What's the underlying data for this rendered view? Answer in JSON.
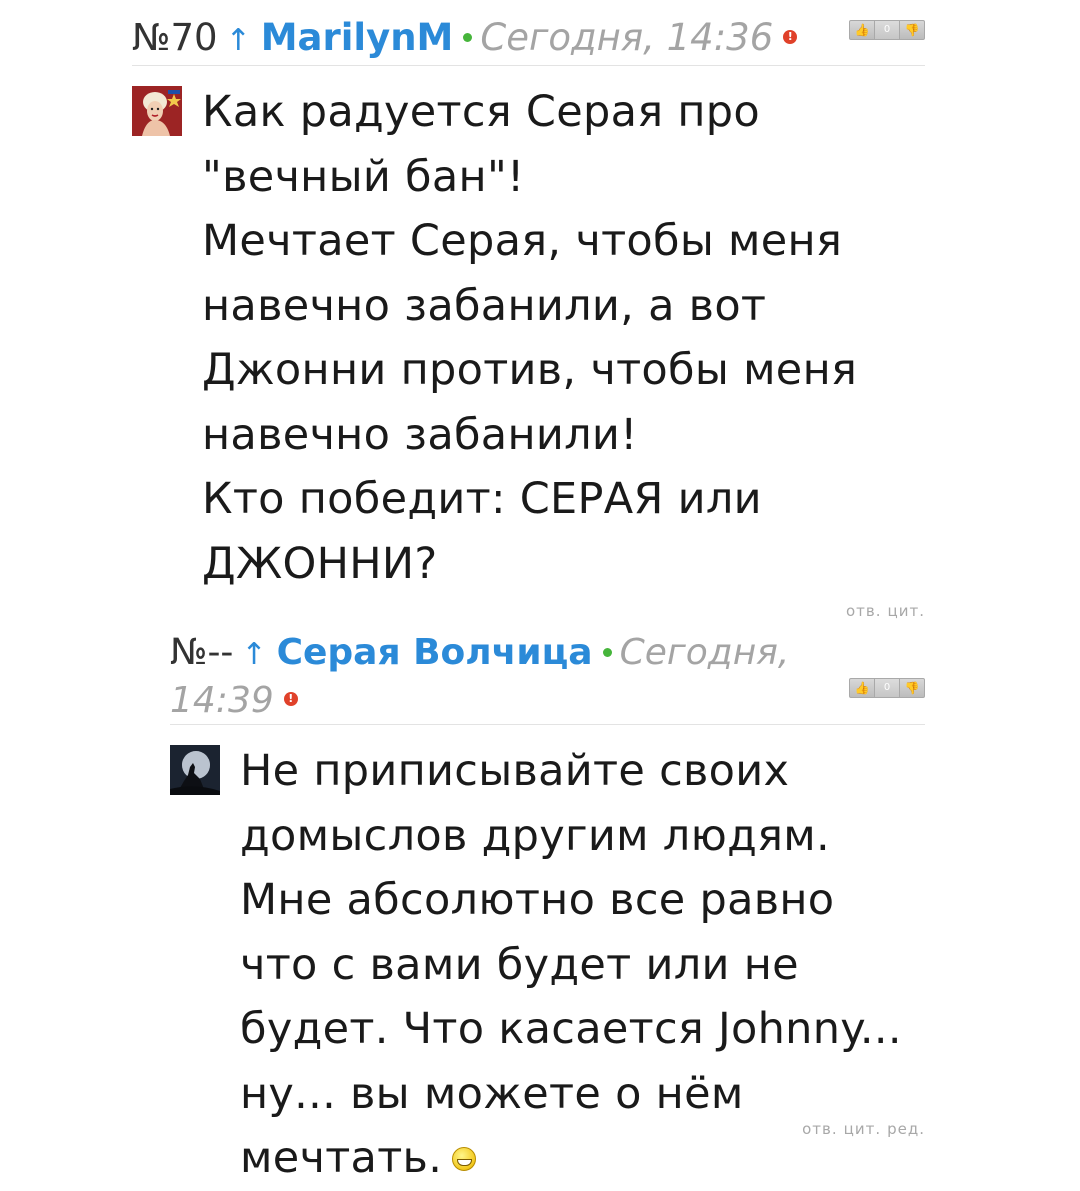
{
  "comments": [
    {
      "number": "№70",
      "arrow": "↑",
      "author": "MarilynM",
      "date": "Сегодня, 14:36",
      "flag": "!",
      "votes": "0",
      "text": "Как радуется Серая про \"вечный бан\"!\nМечтает Серая, чтобы меня навечно забанили, а вот Джонни против, чтобы меня навечно забанили!\nКто победит: СЕРАЯ или ДЖОННИ?",
      "actions": [
        "отв.",
        "цит."
      ]
    },
    {
      "number": "№--",
      "arrow": "↑",
      "author": "Серая Волчица",
      "date": "Сегодня, 14:39",
      "flag": "!",
      "votes": "0",
      "text": "Не приписывайте своих домыслов другим людям. Мне абсолютно все равно что с вами будет или не будет. Что касается Johnny... ну... вы можете о нём мечтать.",
      "actions": [
        "отв.",
        "цит.",
        "ред."
      ]
    }
  ],
  "icons": {
    "thumb_up": "thumbs-up-icon",
    "thumb_down": "thumbs-down-icon",
    "online": "online-status-icon",
    "report": "report-flag-icon",
    "smile": "grin-emoji-icon"
  },
  "colors": {
    "author_link": "#2b8ad8",
    "date": "#a4a4a4",
    "online": "#46b53b",
    "report": "#e0412a"
  }
}
